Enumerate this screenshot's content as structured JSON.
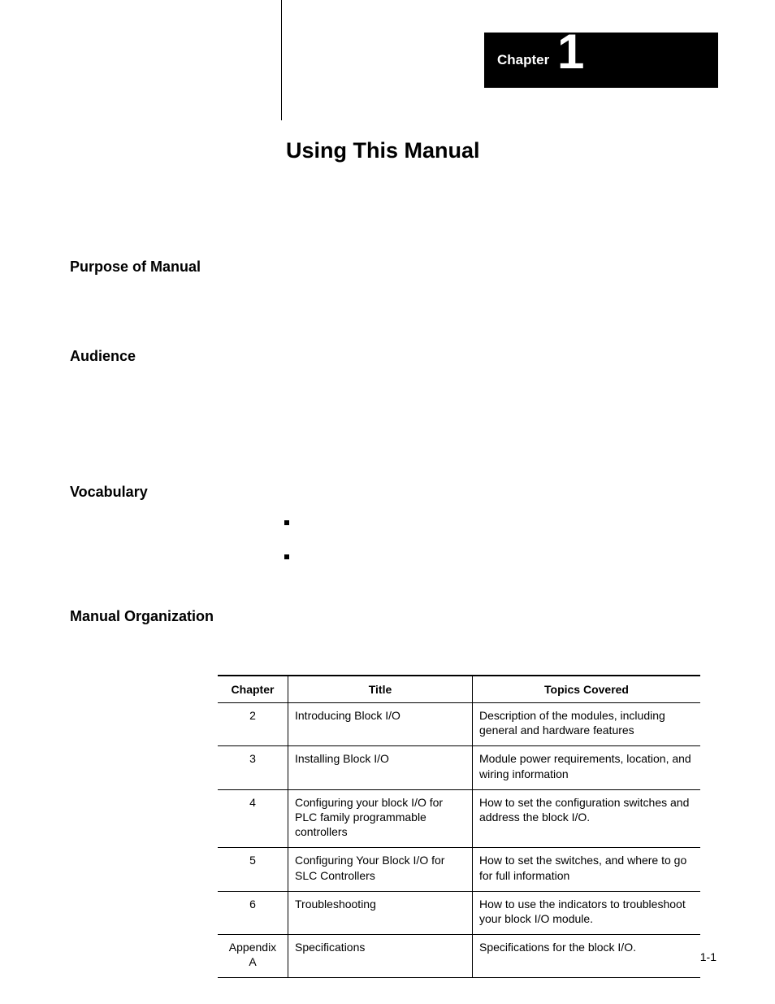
{
  "chapter": {
    "label": "Chapter",
    "number": "1",
    "title": "Using This Manual"
  },
  "sections": {
    "purpose": "Purpose of Manual",
    "audience": "Audience",
    "vocabulary": "Vocabulary",
    "organization": "Manual Organization"
  },
  "table": {
    "headers": {
      "chapter": "Chapter",
      "title": "Title",
      "topics": "Topics Covered"
    },
    "rows": [
      {
        "chapter": "2",
        "title": "Introducing Block I/O",
        "topics": "Description of the modules, including general and hardware features"
      },
      {
        "chapter": "3",
        "title": "Installing Block I/O",
        "topics": "Module power requirements, location, and wiring information"
      },
      {
        "chapter": "4",
        "title": "Configuring your block I/O for PLC family programmable controllers",
        "topics": "How to set the configuration switches and address the block I/O."
      },
      {
        "chapter": "5",
        "title": "Configuring Your Block I/O for SLC Controllers",
        "topics": "How to set the switches, and where to go for full information"
      },
      {
        "chapter": "6",
        "title": "Troubleshooting",
        "topics": "How to use the indicators to troubleshoot your block I/O module."
      },
      {
        "chapter": "Appendix A",
        "title": "Specifications",
        "topics": "Specifications for the block I/O."
      }
    ]
  },
  "pageNumber": "1-1"
}
